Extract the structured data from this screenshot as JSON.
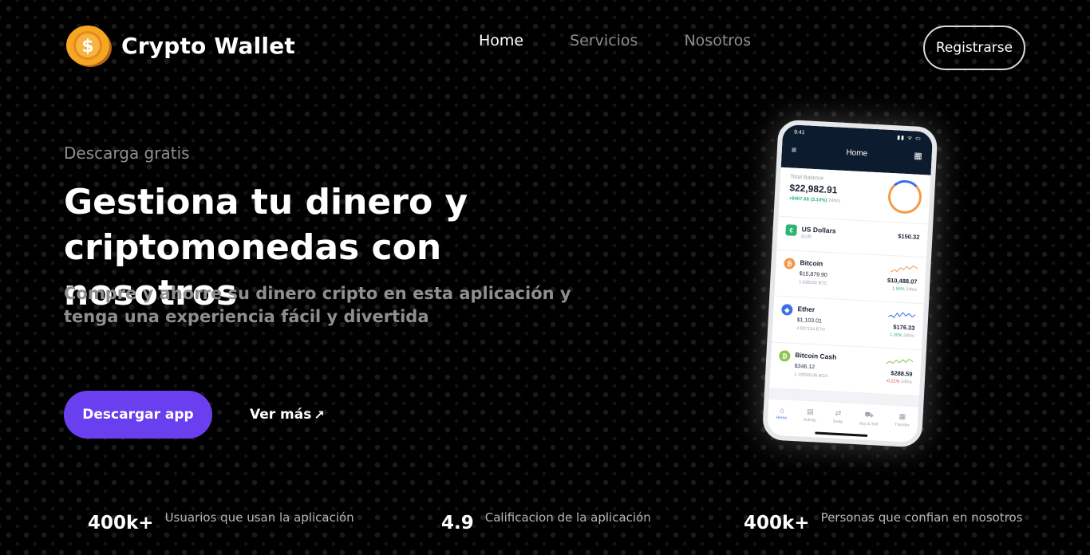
{
  "brand": {
    "name": "Crypto Wallet",
    "logo_icon": "dollar-coin-icon"
  },
  "nav": {
    "items": [
      {
        "label": "Home",
        "active": true
      },
      {
        "label": "Servicios",
        "active": false
      },
      {
        "label": "Nosotros",
        "active": false
      }
    ]
  },
  "register_label": "Registrarse",
  "hero": {
    "eyebrow": "Descarga gratis",
    "headline": "Gestiona tu dinero y criptomonedas con nosotros",
    "subtitle": "Compre y ahorre su dinero cripto en esta aplicación y tenga una experiencia fácil y divertida",
    "download_label": "Descargar app",
    "more_label": "Ver más",
    "more_icon": "arrow-up-right-icon"
  },
  "stats": [
    {
      "value": "400k+",
      "label": "Usuarios que usan la aplicación"
    },
    {
      "value": "4.9",
      "label": "Calificacion de la aplicación"
    },
    {
      "value": "400k+",
      "label": "Personas que confian en nosotros"
    }
  ],
  "phone": {
    "time": "9:41",
    "status": "▮▮ ᯤ ▭",
    "title": "Home",
    "balance_title": "Total Balance",
    "balance_value": "$22,982.91",
    "balance_change": "+$407.68 (3.14%)",
    "balance_period": "24hrs",
    "rows": [
      {
        "name": "US Dollars",
        "sub1": "EUR",
        "value": "$150.32",
        "icon": "€",
        "color": "#2bb673"
      },
      {
        "name": "Bitcoin",
        "sub1": "$15,879.90",
        "sub2": "1.638192 BTC",
        "value": "$10,488.07",
        "change": "1.56%",
        "period": "24hrs",
        "trend": "pos",
        "icon": "₿",
        "color": "#f39a4b",
        "spark_color": "#f39a4b"
      },
      {
        "name": "Ether",
        "sub1": "$1,103.01",
        "sub2": "4.837134 ETH",
        "value": "$176.33",
        "change": "1.30%",
        "period": "24hrs",
        "trend": "pos",
        "icon": "◆",
        "color": "#3d6de8",
        "spark_color": "#3d6de8"
      },
      {
        "name": "Bitcoin Cash",
        "sub1": "$346.12",
        "sub2": "1.19933136 BCH",
        "value": "$288.59",
        "change": "-0.21%",
        "period": "24hrs",
        "trend": "neg",
        "icon": "₿",
        "color": "#8dc351",
        "spark_color": "#8dc351"
      }
    ],
    "tabs": [
      {
        "label": "Home",
        "icon": "⌂",
        "active": true
      },
      {
        "label": "Activity",
        "icon": "▤",
        "active": false
      },
      {
        "label": "Swap",
        "icon": "⇄",
        "active": false
      },
      {
        "label": "Buy & Sell",
        "icon": "⛟",
        "active": false
      },
      {
        "label": "Transfer",
        "icon": "▦",
        "active": false
      }
    ]
  },
  "colors": {
    "accent": "#6a3ff0",
    "coin": "#f5a623"
  }
}
